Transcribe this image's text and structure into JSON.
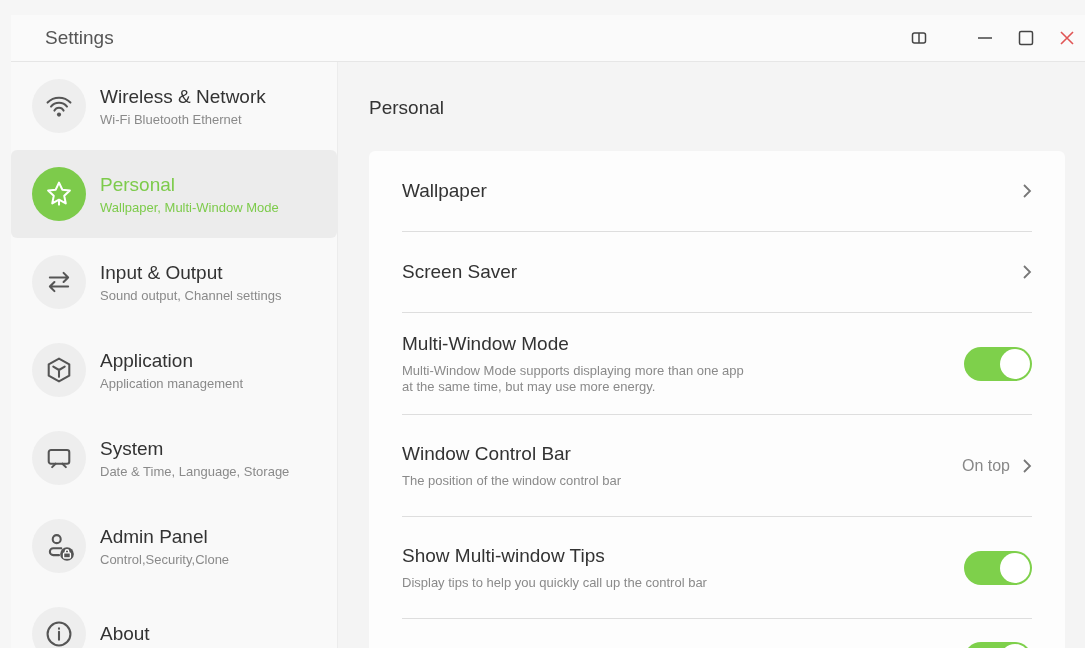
{
  "window": {
    "title": "Settings"
  },
  "sidebar": {
    "items": [
      {
        "title": "Wireless & Network",
        "subtitle": "Wi-Fi Bluetooth Ethernet",
        "selected": false
      },
      {
        "title": "Personal",
        "subtitle": "Wallpaper, Multi-Window Mode",
        "selected": true
      },
      {
        "title": "Input & Output",
        "subtitle": "Sound output, Channel settings",
        "selected": false
      },
      {
        "title": "Application",
        "subtitle": "Application management",
        "selected": false
      },
      {
        "title": "System",
        "subtitle": "Date & Time, Language, Storage",
        "selected": false
      },
      {
        "title": "Admin Panel",
        "subtitle": "Control,Security,Clone",
        "selected": false
      },
      {
        "title": "About",
        "selected": false
      }
    ]
  },
  "content": {
    "heading": "Personal",
    "rows": [
      {
        "kind": "link",
        "title": "Wallpaper"
      },
      {
        "kind": "link",
        "title": "Screen Saver"
      },
      {
        "kind": "toggle",
        "title": "Multi-Window Mode",
        "description": "Multi-Window Mode supports displaying more than one app\nat the same time, but may use more energy.",
        "on": true
      },
      {
        "kind": "link",
        "title": "Window Control Bar",
        "description": "The position of the window control bar",
        "value": "On top"
      },
      {
        "kind": "toggle",
        "title": "Show Multi-window Tips",
        "description": "Display tips to help you quickly call up the control bar",
        "on": true
      },
      {
        "kind": "toggle",
        "on": true
      }
    ]
  }
}
